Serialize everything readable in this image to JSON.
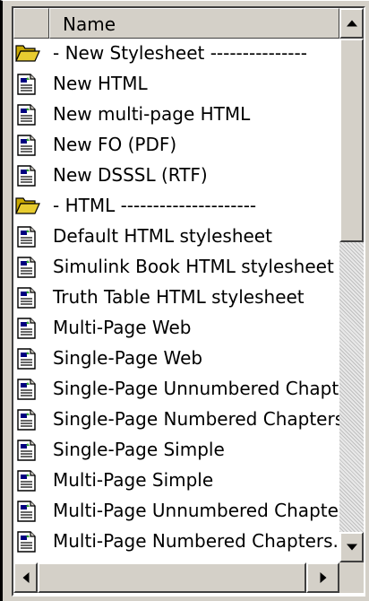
{
  "list": {
    "column_header": "Name",
    "items": [
      {
        "label": "- New Stylesheet ---------------",
        "icon": "folder-open-icon"
      },
      {
        "label": "New HTML",
        "icon": "document-icon"
      },
      {
        "label": "New multi-page HTML",
        "icon": "document-icon"
      },
      {
        "label": "New FO (PDF)",
        "icon": "document-icon"
      },
      {
        "label": "New DSSSL (RTF)",
        "icon": "document-icon"
      },
      {
        "label": "- HTML ---------------------",
        "icon": "folder-open-icon"
      },
      {
        "label": "Default HTML stylesheet",
        "icon": "document-icon"
      },
      {
        "label": "Simulink Book HTML stylesheet",
        "icon": "document-icon"
      },
      {
        "label": "Truth Table HTML stylesheet",
        "icon": "document-icon"
      },
      {
        "label": "Multi-Page Web",
        "icon": "document-icon"
      },
      {
        "label": "Single-Page Web",
        "icon": "document-icon"
      },
      {
        "label": "Single-Page Unnumbered Chapt...",
        "icon": "document-icon"
      },
      {
        "label": "Single-Page Numbered Chapters...",
        "icon": "document-icon"
      },
      {
        "label": "Single-Page Simple",
        "icon": "document-icon"
      },
      {
        "label": "Multi-Page Simple",
        "icon": "document-icon"
      },
      {
        "label": "Multi-Page Unnumbered Chapter...",
        "icon": "document-icon"
      },
      {
        "label": "Multi-Page Numbered Chapters...",
        "icon": "document-icon"
      }
    ]
  },
  "scrollbars": {
    "vertical_position": 0.0,
    "horizontal_position": 0.0
  },
  "colors": {
    "face": "#d4d0c8",
    "folder": "#c8a800",
    "doc_accent": "#000080"
  }
}
